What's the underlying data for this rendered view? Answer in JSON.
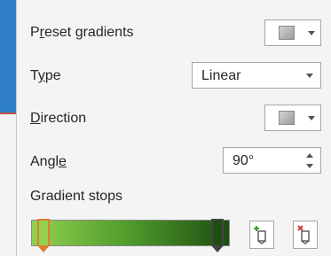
{
  "fields": {
    "preset": {
      "label": "Preset gradients",
      "mnemonic": "r"
    },
    "type": {
      "label": "Type",
      "mnemonic": "y",
      "value": "Linear"
    },
    "direction": {
      "label": "Direction",
      "mnemonic": "D"
    },
    "angle": {
      "label": "Angle",
      "mnemonic": "e",
      "value": "90°"
    }
  },
  "gradient_stops": {
    "label": "Gradient stops",
    "bar_colors": [
      "#92d050",
      "#1e4d12"
    ],
    "stops": [
      {
        "position": 0.0,
        "color": "#92d050",
        "selected": true
      },
      {
        "position": 1.0,
        "color": "#1e4d12",
        "selected": false
      }
    ]
  },
  "icons": {
    "add_stop": "add-gradient-stop-icon",
    "remove_stop": "remove-gradient-stop-icon",
    "dropdown": "chevron-down-icon"
  },
  "colors": {
    "selected_stop_border": "#e07b32",
    "add_icon": "#33a02c",
    "remove_icon": "#d03b3b"
  }
}
